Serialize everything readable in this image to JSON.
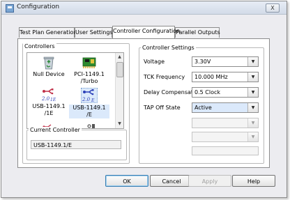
{
  "window": {
    "title": "Configuration",
    "close_label": "X"
  },
  "tabs": [
    {
      "label": "Test Plan Generation"
    },
    {
      "label": "User Settings"
    },
    {
      "label": "Controller Configuration"
    },
    {
      "label": "Parallel Outputs"
    }
  ],
  "controllers": {
    "group_label": "Controllers",
    "items": [
      {
        "label_line1": "Null Device",
        "label_line2": "",
        "icon": "recycle-bin-icon"
      },
      {
        "label_line1": "PCI-1149.1",
        "label_line2": "/Turbo",
        "icon": "pci-card-icon"
      },
      {
        "label_line1": "USB-1149.1",
        "label_line2": "/1E",
        "icon": "usb-icon",
        "badge": "2.0",
        "badge_sub": "1E"
      },
      {
        "label_line1": "USB-1149.1",
        "label_line2": "/E",
        "icon": "usb-icon",
        "badge": "2.0",
        "badge_sub": "E"
      }
    ],
    "current_label": "Current Controller",
    "current_value": "USB-1149.1/E"
  },
  "settings": {
    "group_label": "Controller Settings",
    "voltage_label": "Voltage",
    "voltage_value": "3.30V",
    "tck_label": "TCK Frequency",
    "tck_value": "10.000 MHz",
    "delay_label": "Delay Compensation",
    "delay_value": "0.5 Clock",
    "tap_label": "TAP Off State",
    "tap_value": "Active"
  },
  "buttons": {
    "ok": "OK",
    "cancel": "Cancel",
    "apply": "Apply",
    "help": "Help"
  },
  "colors": {
    "usb_blue": "#2b3fb8",
    "usb_red": "#c03048",
    "pci_green": "#2f8a2f",
    "selection": "#dbe9fb"
  }
}
